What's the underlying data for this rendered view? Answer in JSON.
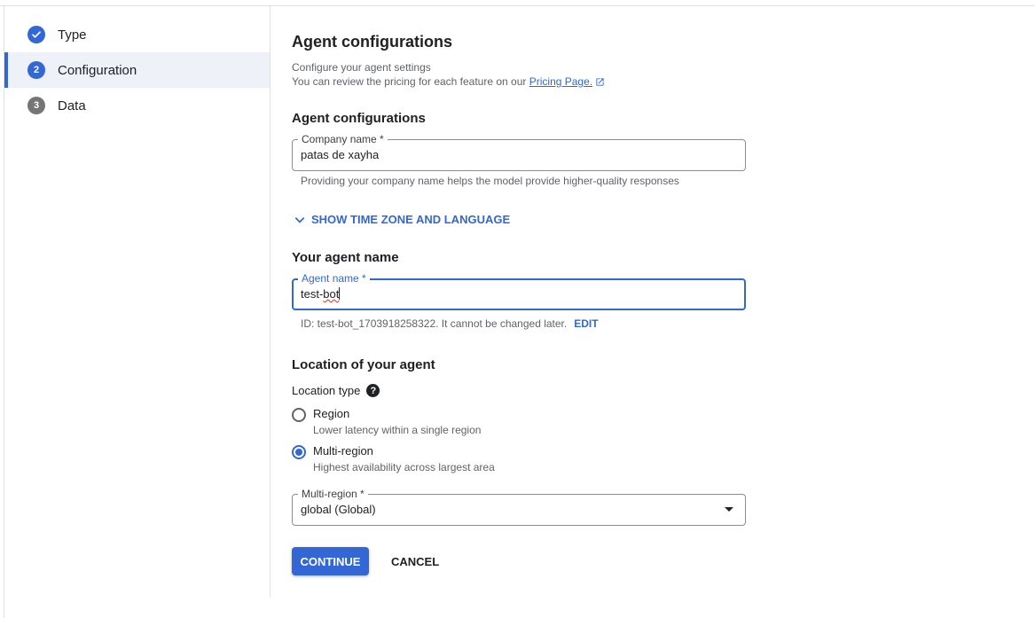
{
  "stepper": {
    "steps": [
      {
        "number": "✓",
        "label": "Type",
        "state": "done"
      },
      {
        "number": "2",
        "label": "Configuration",
        "state": "current"
      },
      {
        "number": "3",
        "label": "Data",
        "state": "pending"
      }
    ]
  },
  "main": {
    "title": "Agent configurations",
    "subtitle_line1": "Configure your agent settings",
    "subtitle_line2": "You can review the pricing for each feature on our ",
    "pricing_link": "Pricing Page.",
    "company_section_title": "Agent configurations",
    "company_field": {
      "label": "Company name *",
      "value": "patas de xayha",
      "hint": "Providing your company name helps the model provide higher-quality responses"
    },
    "toggle_label": "SHOW TIME ZONE AND LANGUAGE",
    "agent_section_title": "Your agent name",
    "agent_field": {
      "label": "Agent name *",
      "value_prefix": "test-",
      "value_misspelled": "bot",
      "id_text": "ID: test-bot_1703918258322. It cannot be changed later.",
      "edit_label": "EDIT"
    },
    "location_section_title": "Location of your agent",
    "location_type_label": "Location type",
    "help_glyph": "?",
    "options": [
      {
        "label": "Region",
        "description": "Lower latency within a single region",
        "checked": false
      },
      {
        "label": "Multi-region",
        "description": "Highest availability across largest area",
        "checked": true
      }
    ],
    "multi_region_select": {
      "label": "Multi-region *",
      "value": "global (Global)"
    },
    "continue_label": "CONTINUE",
    "cancel_label": "CANCEL"
  },
  "colors": {
    "accent": "#3367d6",
    "pending_step": "#757575",
    "hint_text": "#5f6368"
  },
  "icons": {
    "external": "external-link-icon",
    "chevron": "chevron-down-icon",
    "help": "help-icon",
    "dropdown": "dropdown-arrow-icon",
    "check": "check-icon"
  }
}
